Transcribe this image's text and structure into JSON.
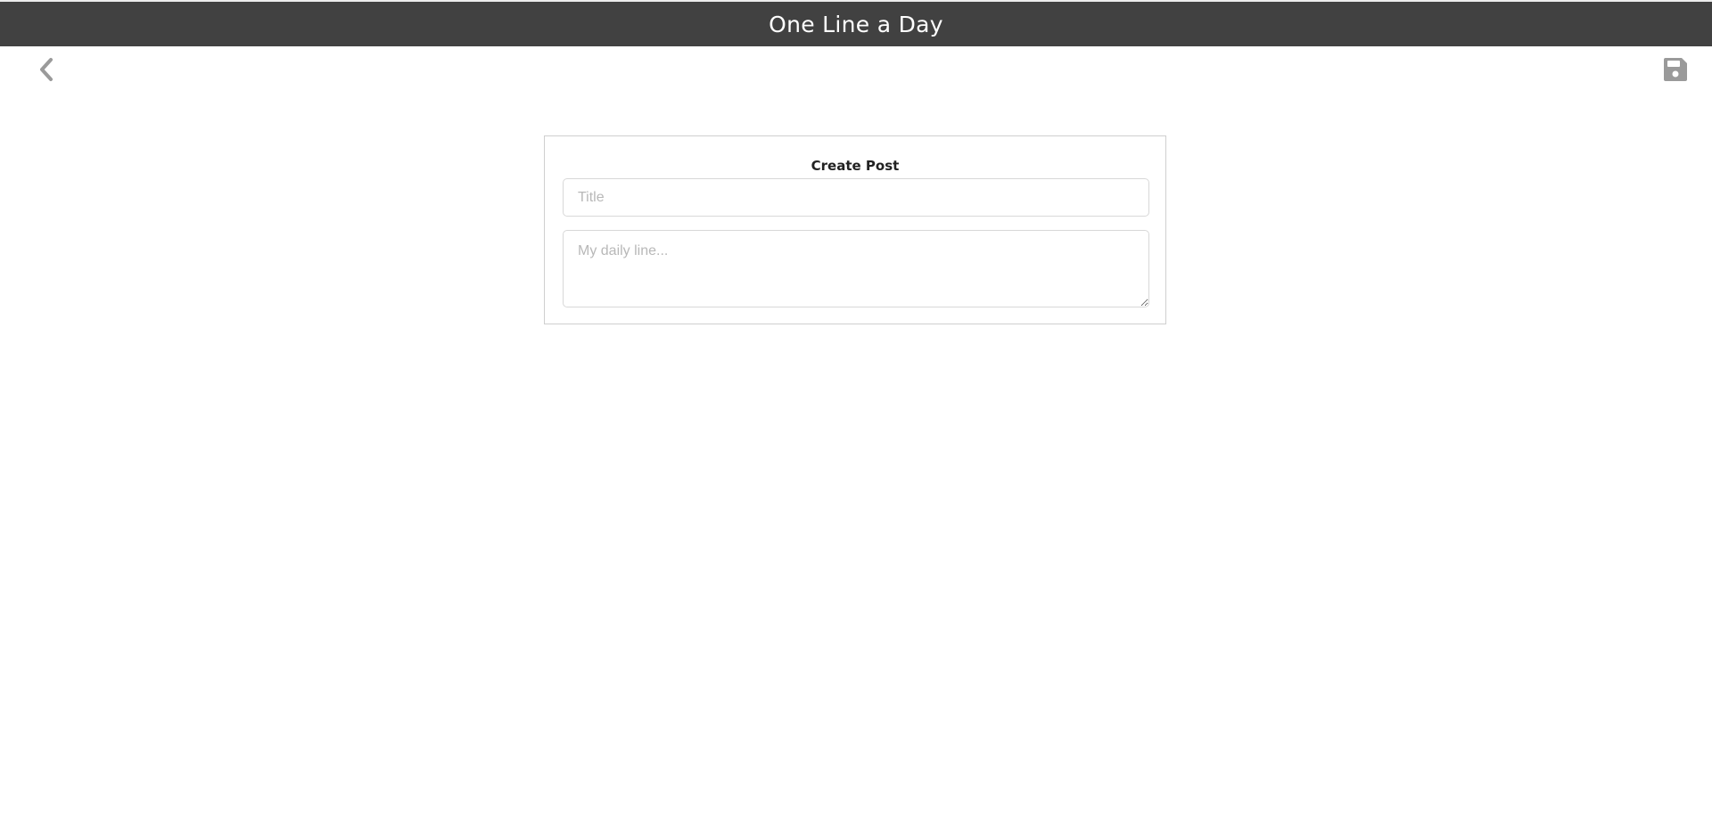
{
  "header": {
    "title": "One Line a Day"
  },
  "nav": {
    "back_icon": "chevron-left-icon",
    "save_icon": "floppy-disk-icon",
    "icon_color": "#9a9a9a"
  },
  "form": {
    "heading": "Create Post",
    "title_placeholder": "Title",
    "title_value": "",
    "line_placeholder": "My daily line...",
    "line_value": ""
  },
  "colors": {
    "header_bg": "#414141",
    "header_text": "#ffffff"
  }
}
